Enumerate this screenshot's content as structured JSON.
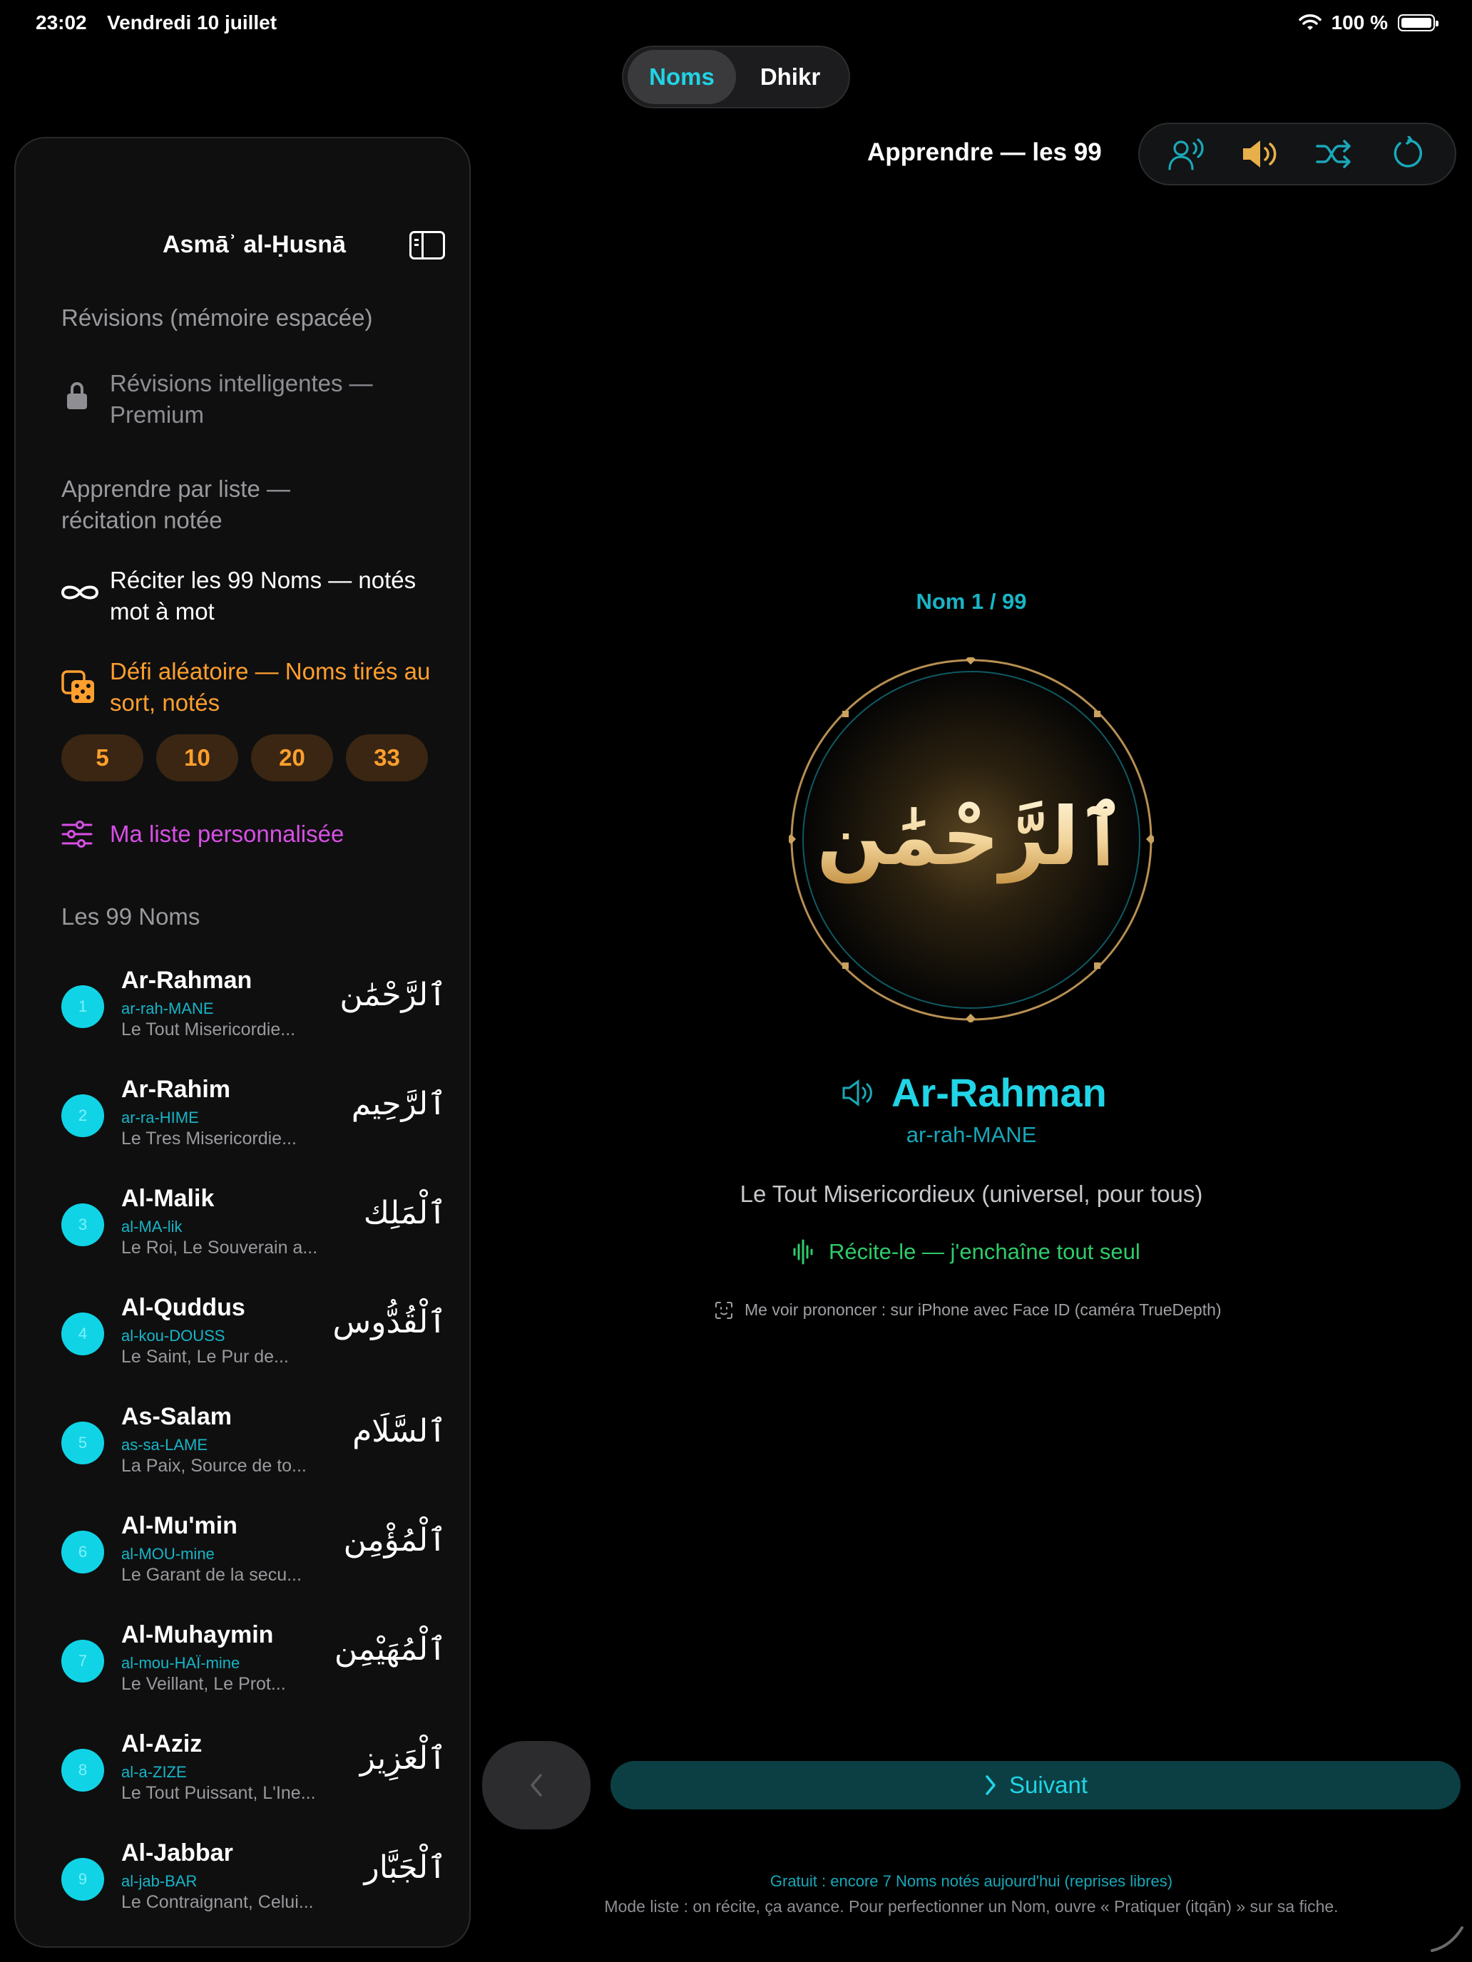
{
  "status": {
    "time": "23:02",
    "date": "Vendredi 10 juillet",
    "battery": "100 %"
  },
  "segmented": {
    "tabs": [
      "Noms",
      "Dhikr"
    ],
    "active": "Noms"
  },
  "sidebar": {
    "title": "Asmāʾ al-Ḥusnā",
    "revisions_header": "Révisions (mémoire espacée)",
    "smart_revisions": "Révisions intelligentes — Premium",
    "list_header": "Apprendre par liste — récitation notée",
    "recite_all": "Réciter les 99 Noms — notés mot à mot",
    "random_challenge": "Défi aléatoire — Noms tirés au sort, notés",
    "chips": [
      "5",
      "10",
      "20",
      "33"
    ],
    "custom_list": "Ma liste personnalisée",
    "names_header": "Les 99 Noms",
    "names": [
      {
        "num": "1",
        "name": "Ar-Rahman",
        "pron": "ar-rah-MANE",
        "meaning": "Le Tout Misericordie...",
        "arabic": "ٱلرَّحْمَٰن"
      },
      {
        "num": "2",
        "name": "Ar-Rahim",
        "pron": "ar-ra-HIME",
        "meaning": "Le Tres Misericordie...",
        "arabic": "ٱلرَّحِيم"
      },
      {
        "num": "3",
        "name": "Al-Malik",
        "pron": "al-MA-lik",
        "meaning": "Le Roi, Le Souverain a...",
        "arabic": "ٱلْمَلِك"
      },
      {
        "num": "4",
        "name": "Al-Quddus",
        "pron": "al-kou-DOUSS",
        "meaning": "Le Saint, Le Pur de...",
        "arabic": "ٱلْقُدُّوس"
      },
      {
        "num": "5",
        "name": "As-Salam",
        "pron": "as-sa-LAME",
        "meaning": "La Paix, Source de to...",
        "arabic": "ٱلسَّلَام"
      },
      {
        "num": "6",
        "name": "Al-Mu'min",
        "pron": "al-MOU-mine",
        "meaning": "Le Garant de la secu...",
        "arabic": "ٱلْمُؤْمِن"
      },
      {
        "num": "7",
        "name": "Al-Muhaymin",
        "pron": "al-mou-HAÏ-mine",
        "meaning": "Le Veillant, Le Prot...",
        "arabic": "ٱلْمُهَيْمِن"
      },
      {
        "num": "8",
        "name": "Al-Aziz",
        "pron": "al-a-ZIZE",
        "meaning": "Le Tout Puissant, L'Ine...",
        "arabic": "ٱلْعَزِيز"
      },
      {
        "num": "9",
        "name": "Al-Jabbar",
        "pron": "al-jab-BAR",
        "meaning": "Le Contraignant, Celui...",
        "arabic": "ٱلْجَبَّار"
      }
    ]
  },
  "main": {
    "title": "Apprendre — les 99",
    "toolbar_icons": [
      "voice-recognition-icon",
      "speaker-icon",
      "shuffle-icon",
      "restart-icon"
    ],
    "counter": "Nom 1 / 99",
    "arabic": "ٱلرَّحْمَٰن",
    "name": "Ar-Rahman",
    "pron": "ar-rah-MANE",
    "meaning": "Le Tout Misericordieux (universel, pour tous)",
    "recite": "Récite-le — j'enchaîne tout seul",
    "faceid_note": "Me voir prononcer : sur iPhone avec Face ID (caméra TrueDepth)",
    "next_label": "Suivant",
    "footer_free": "Gratuit : encore 7 Noms notés aujourd'hui (reprises libres)",
    "footer_mode": "Mode liste : on récite, ça avance. Pour perfectionner un Nom, ouvre « Pratiquer (itqān) » sur sa fiche."
  },
  "colors": {
    "accent": "#21d4e6",
    "orange": "#ff9f2e",
    "magenta": "#d94fe6",
    "green": "#2ecc6a",
    "gold": "#c9a25f"
  }
}
